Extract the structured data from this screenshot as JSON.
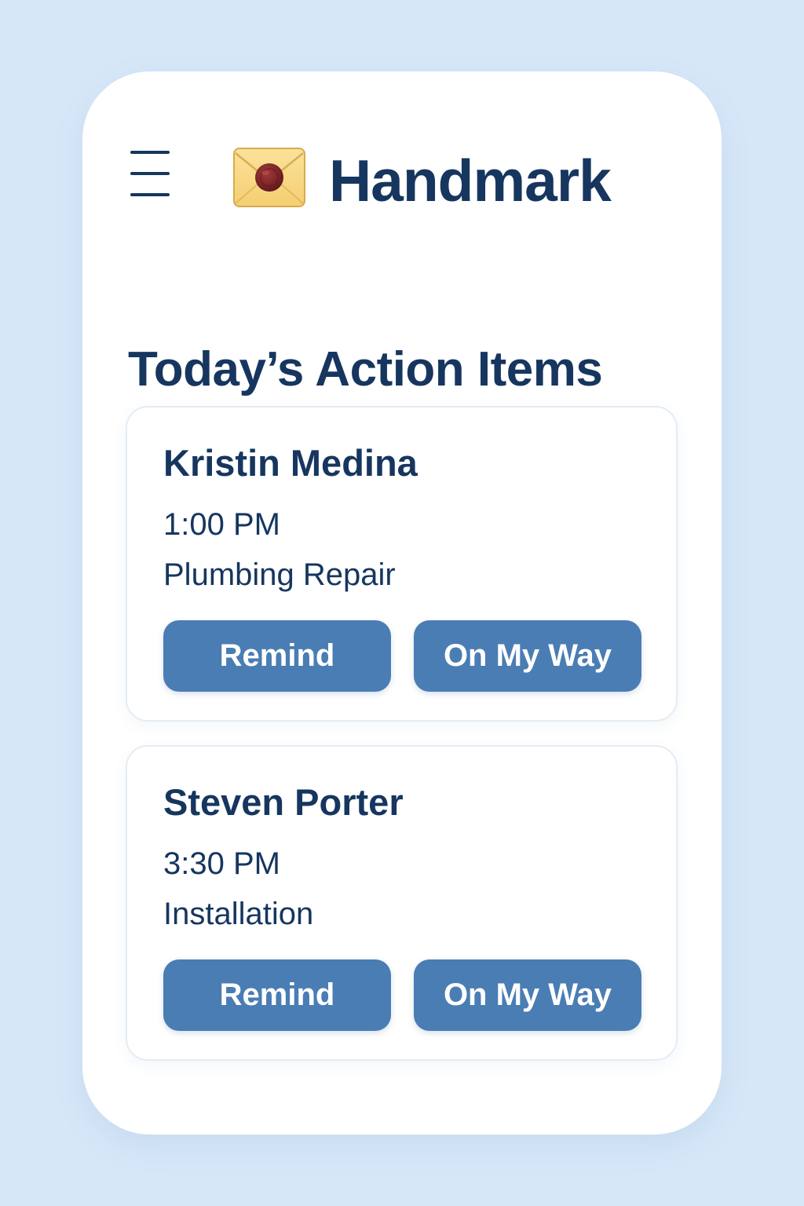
{
  "app": {
    "title": "Handmark",
    "logo_icon": "envelope-wax-seal-icon",
    "menu_icon": "hamburger-menu-icon"
  },
  "section": {
    "title": "Today’s Action Items"
  },
  "items": [
    {
      "name": "Kristin Medina",
      "time": "1:00 PM",
      "service": "Plumbing Repair",
      "remind_label": "Remind",
      "on_my_way_label": "On My Way"
    },
    {
      "name": "Steven Porter",
      "time": "3:30 PM",
      "service": "Installation",
      "remind_label": "Remind",
      "on_my_way_label": "On My Way"
    }
  ],
  "colors": {
    "background": "#d6e7f8",
    "surface": "#ffffff",
    "text_primary": "#16365f",
    "button": "#4a7db3",
    "button_text": "#ffffff",
    "logo_envelope": "#f8d77f",
    "logo_seal": "#7c2628"
  }
}
